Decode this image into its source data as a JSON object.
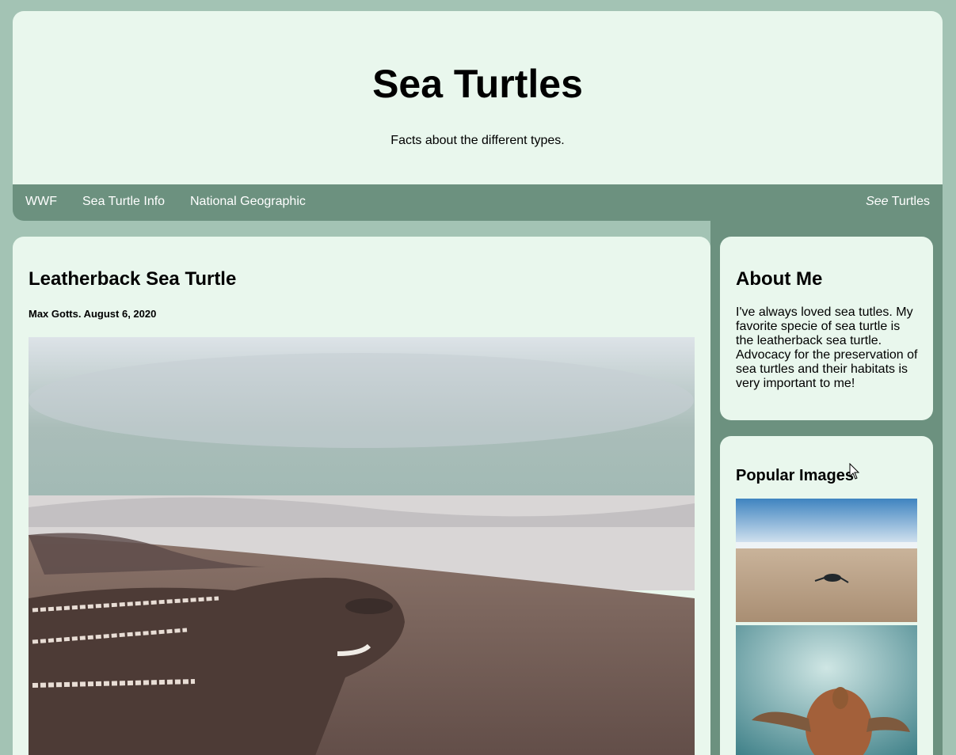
{
  "header": {
    "title": "Sea Turtles",
    "subtitle": "Facts about the different types."
  },
  "nav": {
    "links": [
      "WWF",
      "Sea Turtle Info",
      "National Geographic"
    ],
    "brand_italic": "See",
    "brand_rest": " Turtles"
  },
  "post": {
    "title": "Leatherback Sea Turtle",
    "meta": "Max Gotts. August 6, 2020"
  },
  "about": {
    "title": "About Me",
    "text": "I've always loved sea tutles. My favorite specie of sea turtle is the leatherback sea turtle. Advocacy for the preservation of sea turtles and their habitats is very important to me!"
  },
  "popular": {
    "title": "Popular Images"
  },
  "colors": {
    "page_bg": "#a3c3b4",
    "card_bg": "#e9f7ed",
    "nav_bg": "#6c917f"
  }
}
